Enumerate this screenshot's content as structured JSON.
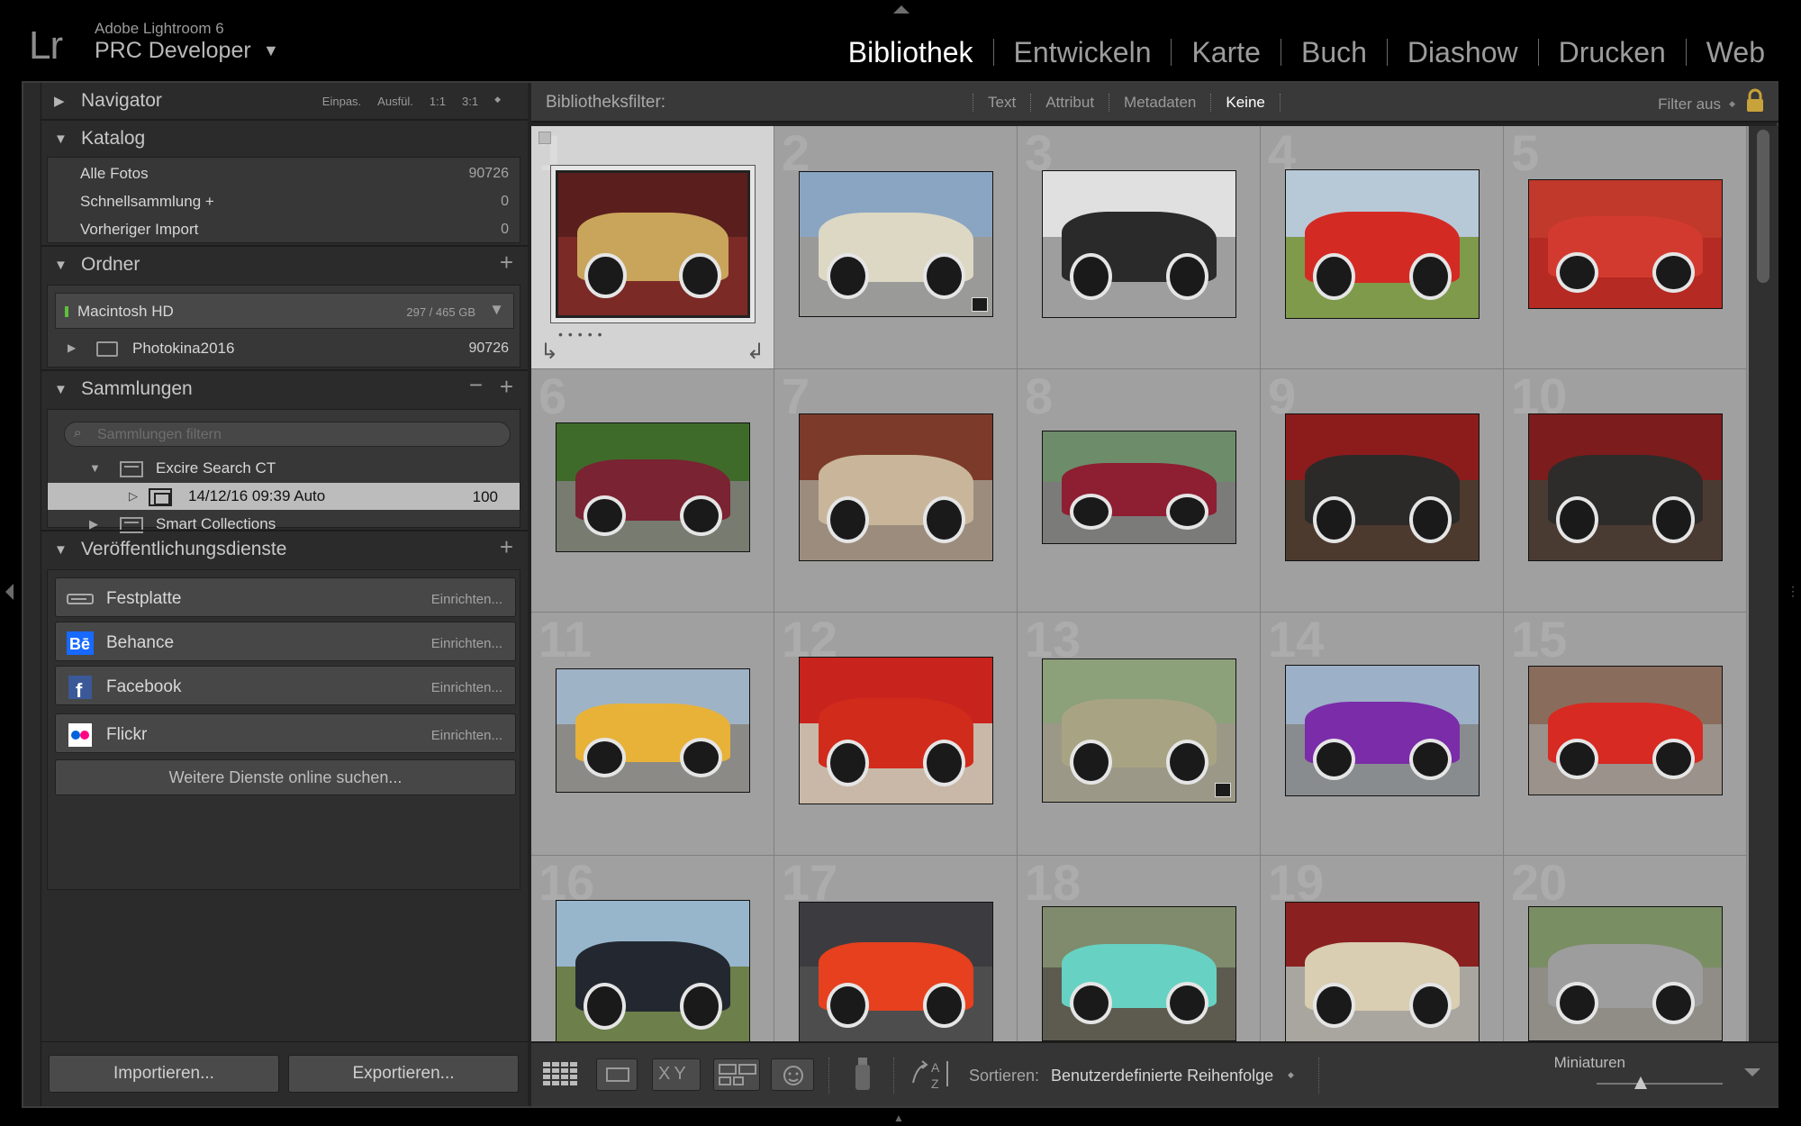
{
  "app": {
    "logo": "Lr",
    "name": "Adobe Lightroom 6",
    "identity": "PRC Developer",
    "identity_arrow": "▼"
  },
  "modules": [
    {
      "label": "Bibliothek",
      "active": true
    },
    {
      "label": "Entwickeln",
      "active": false
    },
    {
      "label": "Karte",
      "active": false
    },
    {
      "label": "Buch",
      "active": false
    },
    {
      "label": "Diashow",
      "active": false
    },
    {
      "label": "Drucken",
      "active": false
    },
    {
      "label": "Web",
      "active": false
    }
  ],
  "navigator": {
    "title": "Navigator",
    "zoom_options": [
      "Einpas.",
      "Ausfül.",
      "1:1",
      "3:1"
    ],
    "zoom_arrow": "◆"
  },
  "catalog": {
    "title": "Katalog",
    "rows": [
      {
        "label": "Alle Fotos",
        "count": "90726"
      },
      {
        "label": "Schnellsammlung +",
        "count": "0"
      },
      {
        "label": "Vorheriger Import",
        "count": "0"
      }
    ]
  },
  "folders": {
    "title": "Ordner",
    "add": "+",
    "volume": {
      "label": "Macintosh HD",
      "usage": "297 / 465 GB",
      "dropdown": "▼"
    },
    "items": [
      {
        "label": "Photokina2016",
        "count": "90726"
      }
    ]
  },
  "collections": {
    "title": "Sammlungen",
    "minus": "−",
    "add": "+",
    "search_placeholder": "Sammlungen filtern",
    "set_label": "Excire Search CT",
    "selected_label": "14/12/16 09:39 Auto",
    "selected_count": "100",
    "smart_label": "Smart Collections"
  },
  "publish": {
    "title": "Veröffentlichungsdienste",
    "add": "+",
    "services": [
      {
        "name": "Festplatte",
        "action": "Einrichten..."
      },
      {
        "name": "Behance",
        "action": "Einrichten..."
      },
      {
        "name": "Facebook",
        "action": "Einrichten..."
      },
      {
        "name": "Flickr",
        "action": "Einrichten..."
      }
    ],
    "more": "Weitere Dienste online suchen..."
  },
  "left_buttons": {
    "import": "Importieren...",
    "export": "Exportieren..."
  },
  "filter": {
    "label": "Bibliotheksfilter:",
    "options": [
      {
        "label": "Text",
        "active": false
      },
      {
        "label": "Attribut",
        "active": false
      },
      {
        "label": "Metadaten",
        "active": false
      },
      {
        "label": "Keine",
        "active": true
      }
    ],
    "preset": "Filter aus",
    "preset_arrow": "◆"
  },
  "grid": {
    "selected_index": 1,
    "cells": [
      {
        "num": "1",
        "sky": "#5a1f1c",
        "ground": "#7b2a25",
        "car": "#c9a55c",
        "badge": false
      },
      {
        "num": "2",
        "sky": "#8aa5c2",
        "ground": "#9a9a98",
        "car": "#ddd8c4",
        "badge": true
      },
      {
        "num": "3",
        "sky": "#e0e0e0",
        "ground": "#9e9e9e",
        "car": "#2a2a2a",
        "badge": false
      },
      {
        "num": "4",
        "sky": "#b7c9d7",
        "ground": "#7f9a4a",
        "car": "#d42a24",
        "badge": false
      },
      {
        "num": "5",
        "sky": "#c0392b",
        "ground": "#b52a22",
        "car": "#d33a2f",
        "badge": false
      },
      {
        "num": "6",
        "sky": "#3f6b2a",
        "ground": "#777b70",
        "car": "#7a2333",
        "badge": false
      },
      {
        "num": "7",
        "sky": "#7c3a2a",
        "ground": "#9c8c7d",
        "car": "#c9b69a",
        "badge": false
      },
      {
        "num": "8",
        "sky": "#6c8c6a",
        "ground": "#7b7b79",
        "car": "#8e1e32",
        "badge": false
      },
      {
        "num": "9",
        "sky": "#8c1c1c",
        "ground": "#4c3a2f",
        "car": "#2b2a28",
        "badge": false
      },
      {
        "num": "10",
        "sky": "#7c1c1c",
        "ground": "#4a3b32",
        "car": "#2e2c2a",
        "badge": false
      },
      {
        "num": "11",
        "sky": "#9fb3c6",
        "ground": "#8c8a86",
        "car": "#e8b238",
        "badge": false
      },
      {
        "num": "12",
        "sky": "#c9231d",
        "ground": "#c9b8a7",
        "car": "#d12b1c",
        "badge": false
      },
      {
        "num": "13",
        "sky": "#8ca07a",
        "ground": "#9b9887",
        "car": "#a8a483",
        "badge": true
      },
      {
        "num": "14",
        "sky": "#9cb0c8",
        "ground": "#888c8e",
        "car": "#7b2ca8",
        "badge": false
      },
      {
        "num": "15",
        "sky": "#8a6c5c",
        "ground": "#9a928b",
        "car": "#d72a22",
        "badge": false
      },
      {
        "num": "16",
        "sky": "#97b6cc",
        "ground": "#6d7f4a",
        "car": "#232830",
        "badge": false
      },
      {
        "num": "17",
        "sky": "#3c3c40",
        "ground": "#4d4d4d",
        "car": "#e6401e",
        "badge": false
      },
      {
        "num": "18",
        "sky": "#7f8b6c",
        "ground": "#5d5b4f",
        "car": "#67d2c3",
        "badge": false
      },
      {
        "num": "19",
        "sky": "#8a2020",
        "ground": "#a9a6a0",
        "car": "#d9cdb2",
        "badge": false
      },
      {
        "num": "20",
        "sky": "#7a8e64",
        "ground": "#8f8d86",
        "car": "#9d9d9d",
        "badge": false
      }
    ]
  },
  "toolbar": {
    "sort_label": "Sortieren:",
    "sort_value": "Benutzerdefinierte Reihenfolge",
    "sort_arrow": "◆",
    "thumb_label": "Miniaturen",
    "thumb_size": 0.35
  },
  "colors": {
    "accent_selected": "#d3d3d3",
    "grid_bg": "#929292",
    "panel_bg": "#2b2b2b",
    "behance": "#1769ff",
    "facebook": "#3b5998",
    "flickr_pink": "#ff0084",
    "flickr_blue": "#0063dc"
  }
}
